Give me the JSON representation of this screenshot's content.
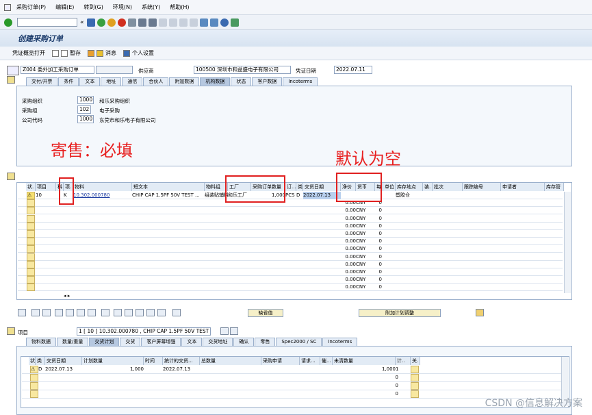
{
  "menu": {
    "items": [
      "采购订单(P)",
      "编辑(E)",
      "转到(G)",
      "环境(N)",
      "系统(Y)",
      "帮助(H)"
    ]
  },
  "title": "创建采购订单",
  "app_toolbar": {
    "buttons": [
      "凭证概览打开",
      "暂存",
      "消息",
      "个人设置"
    ]
  },
  "header": {
    "doc_type": "Z004 委外加工采购订单",
    "vendor_label": "供应商",
    "vendor": "100500 深圳市和益盛电子有限公司",
    "doc_date_label": "凭证日期",
    "doc_date": "2022.07.11"
  },
  "header_tabs": [
    "交付/开票",
    "条件",
    "文本",
    "地址",
    "通信",
    "合伙人",
    "附加数据",
    "机构数据",
    "状态",
    "客户数据",
    "Incoterms"
  ],
  "org": {
    "rows": [
      {
        "label": "采购组织",
        "code": "1000",
        "name": "和乐采购组织"
      },
      {
        "label": "采购组",
        "code": "102",
        "name": "电子采购"
      },
      {
        "label": "公司代码",
        "code": "1000",
        "name": "东莞市和乐电子有限公司"
      }
    ]
  },
  "annotations": {
    "consign": "寄售：必填",
    "default_empty": "默认为空"
  },
  "items_grid": {
    "headers": [
      "状.",
      "项目",
      "科",
      "项.",
      "物料",
      "短文本",
      "物料组",
      "工厂",
      "采购订单数量",
      "订...",
      "类",
      "交货日期",
      "净价",
      "货币",
      "每",
      "单位",
      "库存地点",
      "装.",
      "批次",
      "跟踪编号",
      "申请者",
      "库存管"
    ],
    "row1": {
      "item": "10",
      "acct": "",
      "cat": "K",
      "material": "10.302.000780",
      "text": "CHIP CAP 1.5PF 50V TEST ...",
      "matgroup": "组装贴辅料",
      "plant": "和乐工厂",
      "qty": "1,000",
      "unit": "PCS",
      "d": "D",
      "date": "2022.07.13",
      "sloc": "塑胶仓"
    },
    "empty_price": "0.00",
    "empty_cur": "CNY",
    "empty_per": "0"
  },
  "item_buttons": {
    "default_value": "缺省值",
    "add_planning": "附加计划调整"
  },
  "item_section": {
    "label": "项目",
    "selector": "1 [ 10 ] 10.302.000780 , CHIP CAP 1.5PF 50V TEST ..."
  },
  "item_tabs": [
    "物料数据",
    "数量/重量",
    "交货计划",
    "交货",
    "客户屏幕增强",
    "文本",
    "交货地址",
    "确认",
    "零售",
    "Spec2000 / SC",
    "Incoterms"
  ],
  "schedule_grid": {
    "headers": [
      "状.",
      "类",
      "交货日期",
      "计划数量",
      "时间",
      "统计的交货...",
      "总数量",
      "采购申请",
      "请求...",
      "催...",
      "未清数量",
      "计..",
      "关."
    ],
    "row1": {
      "d": "D",
      "date": "2022.07.13",
      "qty": "1,000",
      "stat_date": "2022.07.13",
      "open": "1,000",
      "calc": "1"
    },
    "zero": "0"
  },
  "watermark": "CSDN @信息解决方案"
}
